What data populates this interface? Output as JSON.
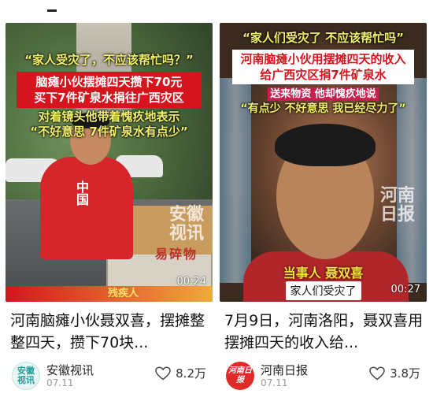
{
  "feed": {
    "cards": [
      {
        "thumb": {
          "top_caption": "“家人受灾了，不应该帮忙吗？”",
          "red_box_lines": [
            "脑瘫小伙摆摊四天攒下70元",
            "买下7件矿泉水捐往广西灾区"
          ],
          "green_lines": [
            "对着镜头他带着愧疚地表示",
            "“不好意思 7件矿泉水有点少”"
          ],
          "shirt_text": "中国",
          "watermark": "安徽\n视讯",
          "box_text": "易碎物",
          "duration": "00:24",
          "bottom_strip": "残疾人"
        },
        "title": "河南脑瘫小伙聂双喜，摆摊整整四天，攒下70块...",
        "source": "安徽视讯",
        "avatar_text": "安徽\n视讯",
        "date": "07.11",
        "likes": "8.2万"
      },
      {
        "thumb": {
          "top_caption": "“家人们受灾了 不应该帮忙吗”",
          "white_box_lines": [
            "河南脑瘫小伙用摆摊四天的收入",
            "给广西灾区捐7件矿泉水"
          ],
          "pink_line": "送来物资 他却愧疚地说",
          "green_line": "“有点少 不好意思 我已经尽力了”",
          "watermark": "河南\n日报",
          "speaker": "当事人 聂双喜",
          "subtitle": "家人们受灾了",
          "duration": "00:27"
        },
        "title": "7月9日，河南洛阳，聂双喜用摆摊四天的收入给...",
        "source": "河南日报",
        "avatar_text": "河南日报",
        "date": "07.11",
        "likes": "3.8万"
      }
    ]
  }
}
